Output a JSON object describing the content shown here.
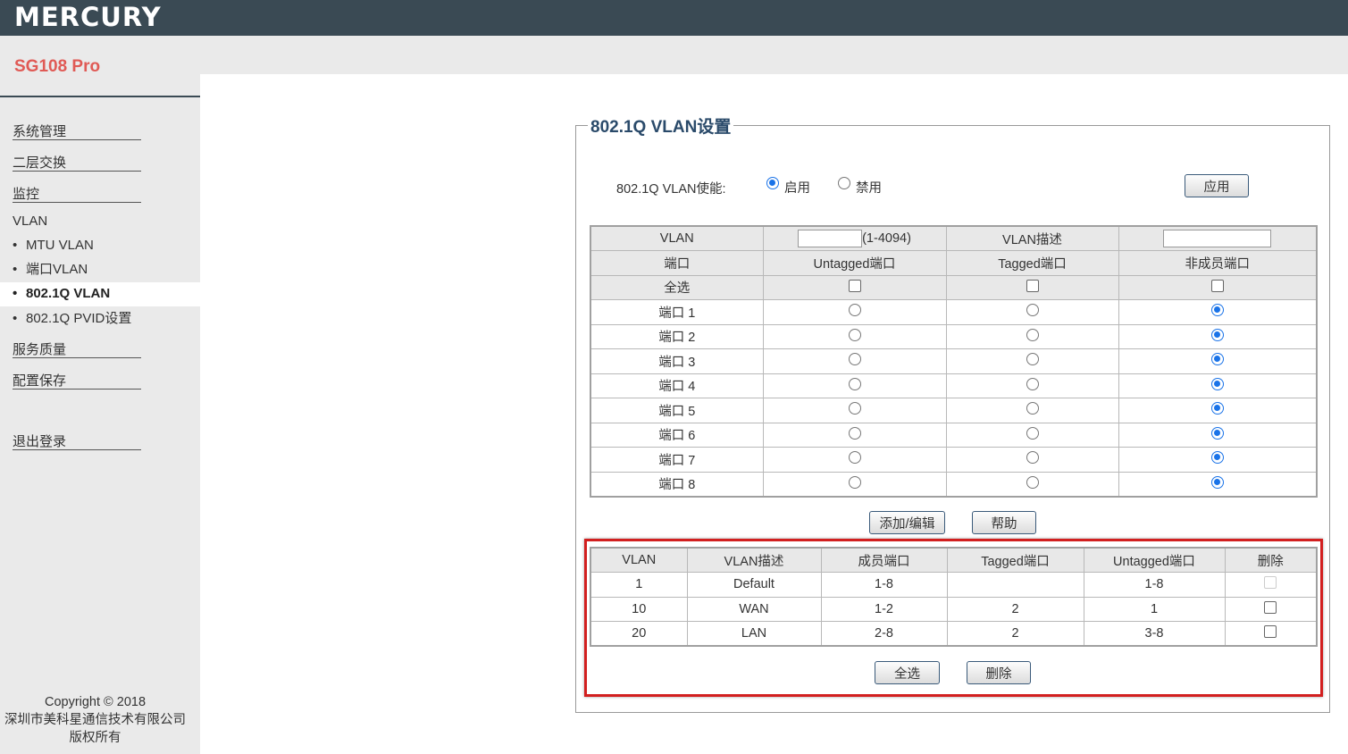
{
  "brand": "MERCURY",
  "model": "SG108 Pro",
  "nav": {
    "sys": "系统管理",
    "l2": "二层交换",
    "mon": "监控",
    "vlan": "VLAN",
    "mtu": "MTU VLAN",
    "port": "端口VLAN",
    "q": "802.1Q VLAN",
    "pvid": "802.1Q PVID设置",
    "qos": "服务质量",
    "save": "配置保存",
    "logout": "退出登录"
  },
  "copyright": {
    "l1": "Copyright © 2018",
    "l2": "深圳市美科星通信技术有限公司",
    "l3": "版权所有"
  },
  "panel": {
    "title": "802.1Q VLAN设置",
    "enable_label": "802.1Q VLAN使能:",
    "on": "启用",
    "off": "禁用",
    "apply": "应用",
    "enabled": true
  },
  "form": {
    "vlan": "VLAN",
    "range": "(1-4094)",
    "desc": "VLAN描述",
    "port": "端口",
    "untagged": "Untagged端口",
    "tagged": "Tagged端口",
    "nonmember": "非成员端口",
    "select_all": "全选",
    "ports": [
      "端口 1",
      "端口 2",
      "端口 3",
      "端口 4",
      "端口 5",
      "端口 6",
      "端口 7",
      "端口 8"
    ],
    "selected": "nonmember"
  },
  "buttons": {
    "add": "添加/编辑",
    "help": "帮助",
    "all": "全选",
    "del": "删除"
  },
  "list": {
    "headers": [
      "VLAN",
      "VLAN描述",
      "成员端口",
      "Tagged端口",
      "Untagged端口",
      "删除"
    ],
    "rows": [
      {
        "vlan": "1",
        "desc": "Default",
        "member": "1-8",
        "tagged": "",
        "untagged": "1-8",
        "deletable": false
      },
      {
        "vlan": "10",
        "desc": "WAN",
        "member": "1-2",
        "tagged": "2",
        "untagged": "1",
        "deletable": true
      },
      {
        "vlan": "20",
        "desc": "LAN",
        "member": "2-8",
        "tagged": "2",
        "untagged": "3-8",
        "deletable": true
      }
    ]
  },
  "colors": {
    "header": "#3a4a54",
    "model": "#e05a55",
    "accent": "#1a73e8",
    "highlight": "#d21f1f"
  }
}
